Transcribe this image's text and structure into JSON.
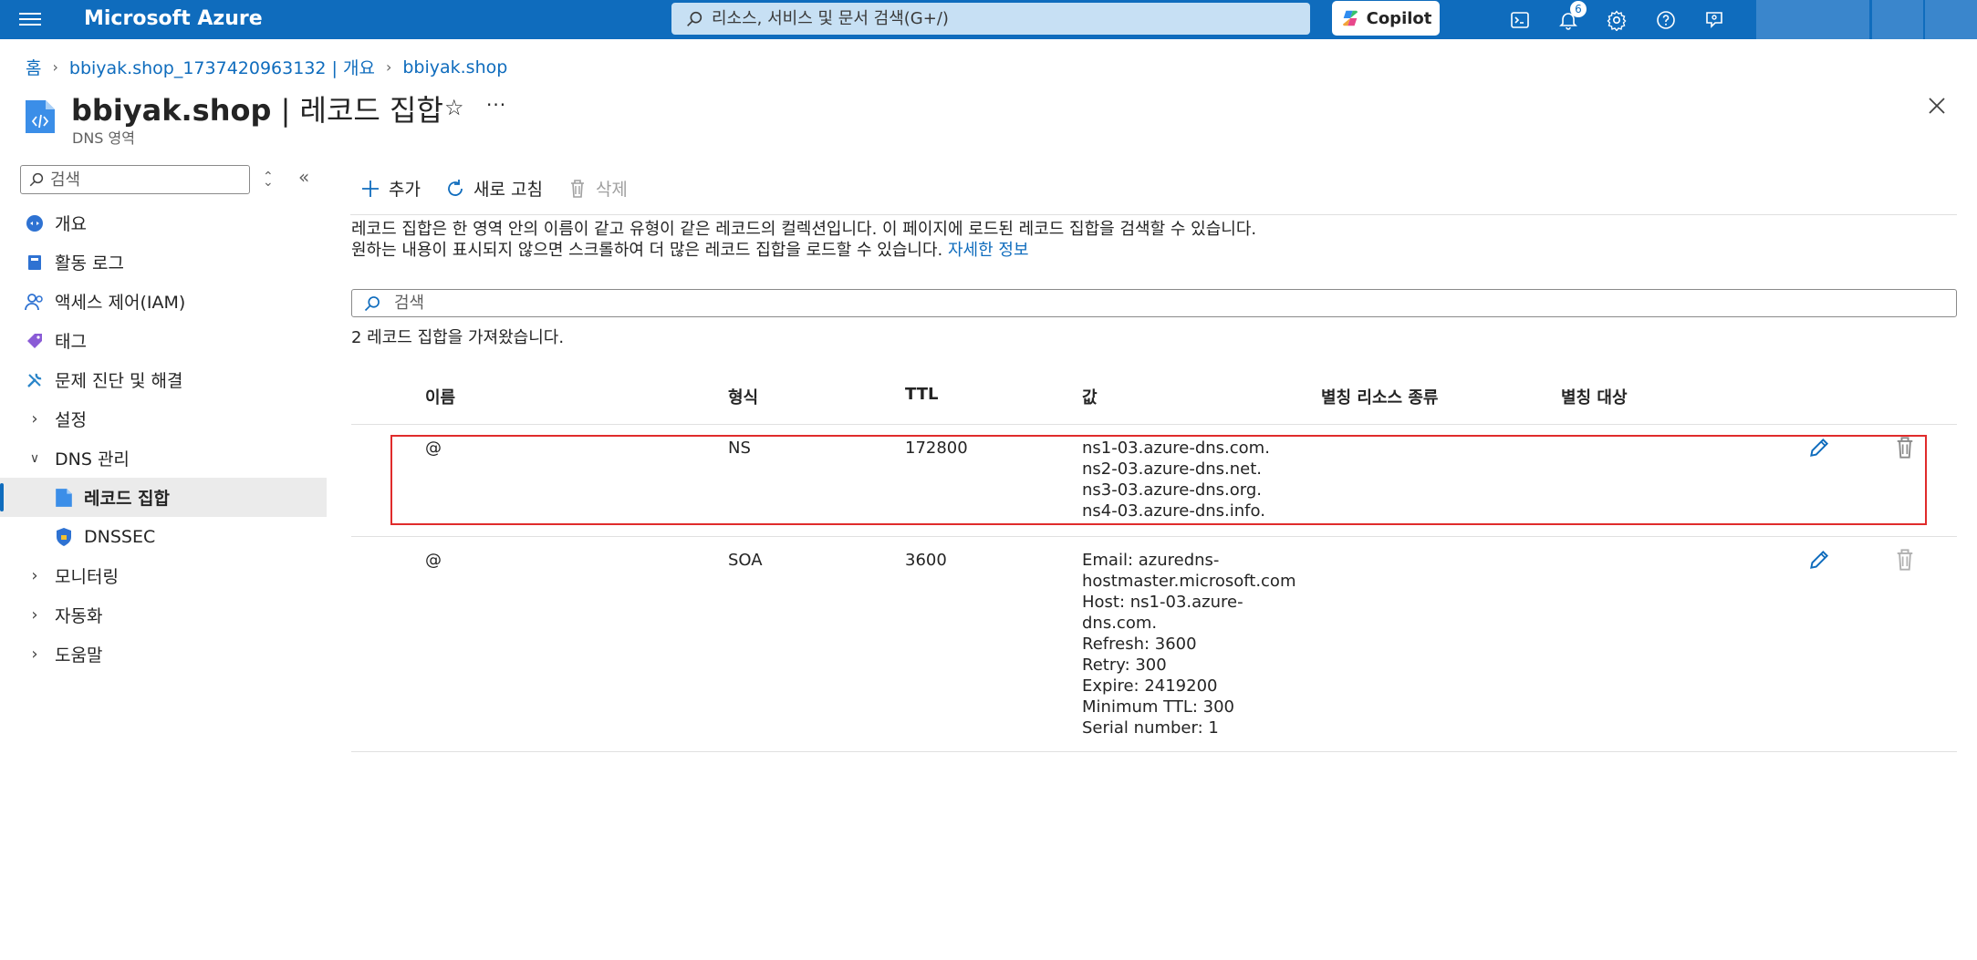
{
  "app": {
    "brand": "Microsoft Azure"
  },
  "topbar": {
    "search_placeholder": "리소스, 서비스 및 문서 검색(G+/)",
    "copilot_label": "Copilot",
    "notification_count": "6"
  },
  "breadcrumb": {
    "items": [
      "홈",
      "bbiyak.shop_1737420963132 | 개요",
      "bbiyak.shop"
    ]
  },
  "header": {
    "title_resource": "bbiyak.shop",
    "title_sep": " | ",
    "title_page": "레코드 집합",
    "subtitle": "DNS 영역",
    "more": "···"
  },
  "sidebar": {
    "search_placeholder": "검색",
    "items": [
      {
        "label": "개요"
      },
      {
        "label": "활동 로그"
      },
      {
        "label": "액세스 제어(IAM)"
      },
      {
        "label": "태그"
      },
      {
        "label": "문제 진단 및 해결"
      },
      {
        "label": "설정"
      },
      {
        "label": "DNS 관리"
      },
      {
        "label": "레코드 집합"
      },
      {
        "label": "DNSSEC"
      },
      {
        "label": "모니터링"
      },
      {
        "label": "자동화"
      },
      {
        "label": "도움말"
      }
    ]
  },
  "toolbar": {
    "add": "추가",
    "refresh": "새로 고침",
    "delete": "삭제"
  },
  "main": {
    "description": "레코드 집합은 한 영역 안의 이름이 같고 유형이 같은 레코드의 컬렉션입니다. 이 페이지에 로드된 레코드 집합을 검색할 수 있습니다. 원하는 내용이 표시되지 않으면 스크롤하여 더 많은 레코드 집합을 로드할 수 있습니다.",
    "learn_more": "자세한 정보",
    "filter_placeholder": "검색",
    "result_count": "2 레코드 집합을 가져왔습니다."
  },
  "table": {
    "columns": [
      "이름",
      "형식",
      "TTL",
      "값",
      "별칭 리소스 종류",
      "별칭 대상"
    ],
    "rows": [
      {
        "name": "@",
        "type": "NS",
        "ttl": "172800",
        "value": [
          "ns1-03.azure-dns.com.",
          "ns2-03.azure-dns.net.",
          "ns3-03.azure-dns.org.",
          "ns4-03.azure-dns.info."
        ],
        "alias_type": "",
        "alias_target": ""
      },
      {
        "name": "@",
        "type": "SOA",
        "ttl": "3600",
        "value": [
          "Email: azuredns-",
          "hostmaster.microsoft.com",
          "Host: ns1-03.azure-",
          "dns.com.",
          "Refresh: 3600",
          "Retry: 300",
          "Expire: 2419200",
          "Minimum TTL: 300",
          "Serial number: 1"
        ],
        "alias_type": "",
        "alias_target": ""
      }
    ]
  },
  "colors": {
    "topbar": "#0f6cbd",
    "link": "#0f6cbd",
    "highlight": "#e02b2b"
  }
}
